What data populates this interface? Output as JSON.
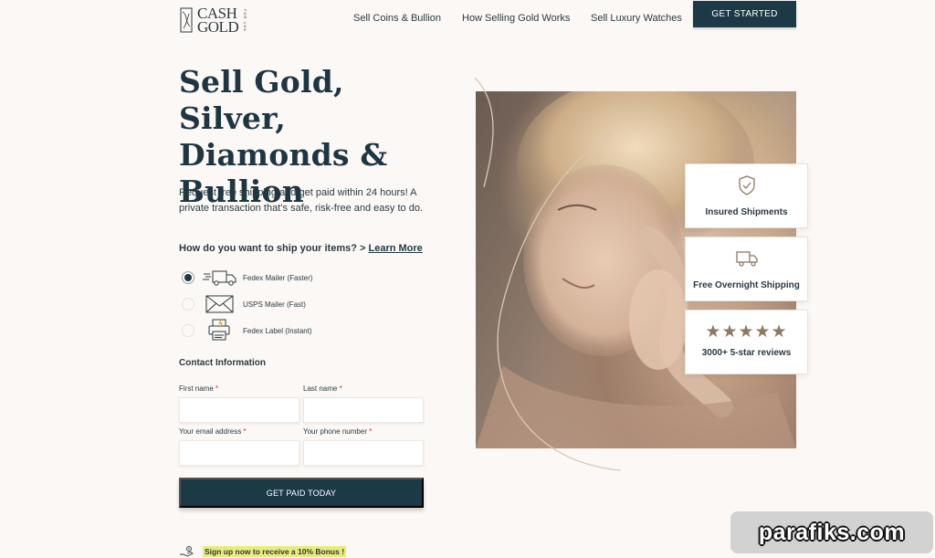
{
  "brand": {
    "logo_line1": "CASH",
    "logo_line2": "GOLD",
    "logo_side": "FOR USA"
  },
  "nav": {
    "items": [
      "Sell Coins & Bullion",
      "How Selling Gold Works",
      "Sell Luxury Watches"
    ],
    "cta": "GET STARTED"
  },
  "hero": {
    "title": "Sell Gold, Silver, Diamonds & Bullion",
    "subtitle": "Request free shipping and get paid within 24 hours! A private transaction that’s safe, risk-free and easy to do."
  },
  "shipping": {
    "question": "How do you want to ship your items? >",
    "learn_more": "Learn More",
    "options": [
      {
        "label": "Fedex Mailer (Faster)",
        "icon": "delivery-truck-icon",
        "selected": true
      },
      {
        "label": "USPS Mailer (Fast)",
        "icon": "envelope-icon",
        "selected": false
      },
      {
        "label": "Fedex Label (Instant)",
        "icon": "printer-icon",
        "selected": false
      }
    ]
  },
  "contact": {
    "heading": "Contact Information",
    "first_name": "First name",
    "last_name": "Last name",
    "email": "Your email address",
    "phone": "Your phone number",
    "required_mark": "*",
    "submit": "GET PAID TODAY"
  },
  "bonus": {
    "text": "Sign up now to receive a 10% Bonus !",
    "highlight_color": "#e9ec7a"
  },
  "features": [
    {
      "label": "Insured Shipments",
      "icon": "shield-check-icon"
    },
    {
      "label": "Free Overnight Shipping",
      "icon": "truck-icon"
    },
    {
      "label": "3000+ 5-star reviews",
      "icon": "stars-icon",
      "stars": "★★★★★",
      "rating": 5
    }
  ],
  "watermark": "parafiks.com",
  "colors": {
    "primary": "#1c3a45",
    "background": "#fcf8f5",
    "accent_gold": "#8c7a64"
  }
}
